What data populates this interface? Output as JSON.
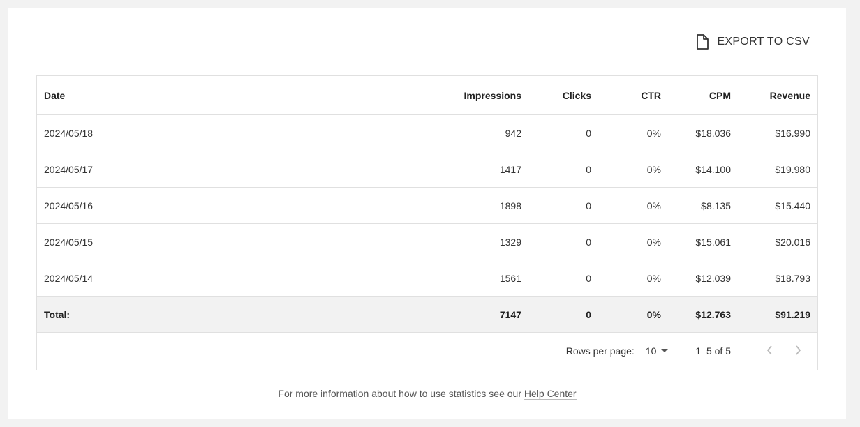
{
  "toolbar": {
    "export_label": "EXPORT TO CSV",
    "export_icon": "file-icon"
  },
  "table": {
    "headers": [
      "Date",
      "Impressions",
      "Clicks",
      "CTR",
      "CPM",
      "Revenue"
    ],
    "rows": [
      [
        "2024/05/18",
        "942",
        "0",
        "0%",
        "$18.036",
        "$16.990"
      ],
      [
        "2024/05/17",
        "1417",
        "0",
        "0%",
        "$14.100",
        "$19.980"
      ],
      [
        "2024/05/16",
        "1898",
        "0",
        "0%",
        "$8.135",
        "$15.440"
      ],
      [
        "2024/05/15",
        "1329",
        "0",
        "0%",
        "$15.061",
        "$20.016"
      ],
      [
        "2024/05/14",
        "1561",
        "0",
        "0%",
        "$12.039",
        "$18.793"
      ]
    ],
    "total": [
      "Total:",
      "7147",
      "0",
      "0%",
      "$12.763",
      "$91.219"
    ]
  },
  "pagination": {
    "rows_per_page_label": "Rows per page:",
    "rows_per_page_value": "10",
    "range_text": "1–5 of 5"
  },
  "footer": {
    "text": "For more information about how to use statistics see our",
    "link_text": "Help Center"
  },
  "colors": {
    "background": "#f2f2f2",
    "card": "#ffffff",
    "border": "#e0e0e0",
    "total_row_bg": "#f2f2f2"
  }
}
